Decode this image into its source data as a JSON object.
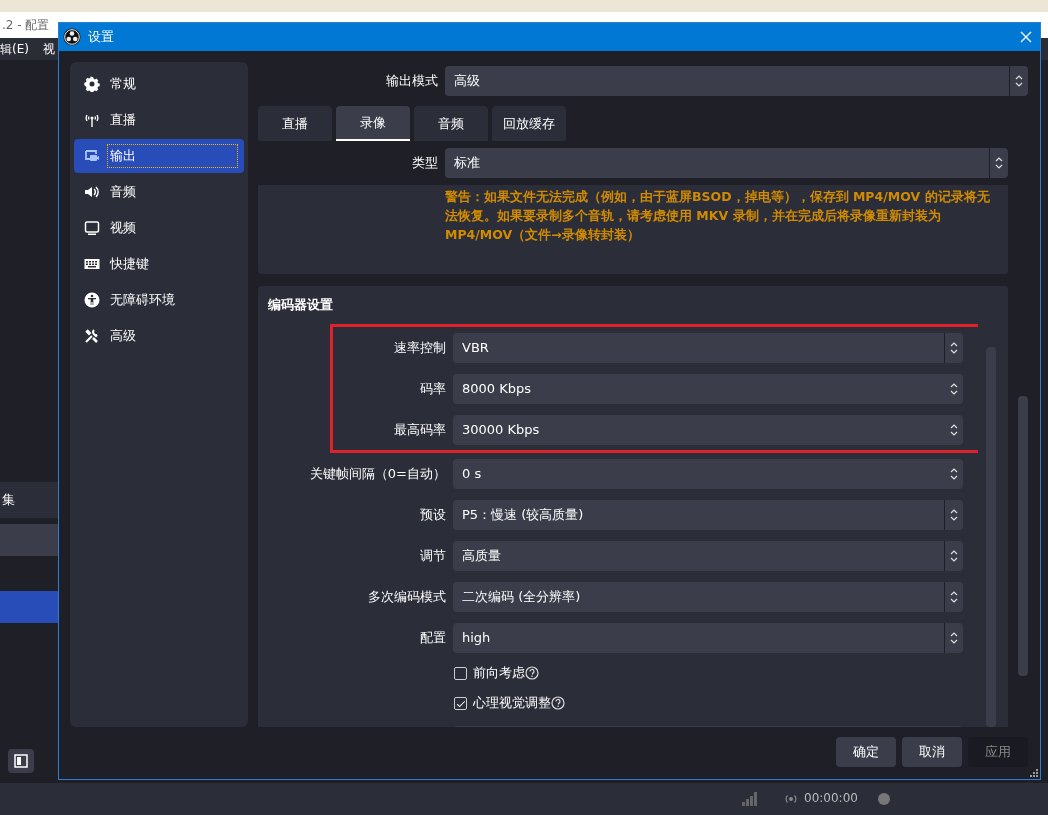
{
  "background_window": {
    "title": ".2 - 配置",
    "menu": [
      "辑(E)",
      "视"
    ],
    "dock_title": "集",
    "status_time": "00:00:00"
  },
  "window": {
    "title": "设置"
  },
  "sidebar": {
    "items": [
      {
        "label": "常规",
        "selected": false
      },
      {
        "label": "直播",
        "selected": false
      },
      {
        "label": "输出",
        "selected": true
      },
      {
        "label": "音频",
        "selected": false
      },
      {
        "label": "视频",
        "selected": false
      },
      {
        "label": "快捷键",
        "selected": false
      },
      {
        "label": "无障碍环境",
        "selected": false
      },
      {
        "label": "高级",
        "selected": false
      }
    ]
  },
  "output_mode": {
    "label": "输出模式",
    "value": "高级"
  },
  "tabs": [
    {
      "label": "直播",
      "selected": false
    },
    {
      "label": "录像",
      "selected": true
    },
    {
      "label": "音频",
      "selected": false
    },
    {
      "label": "回放缓存",
      "selected": false
    }
  ],
  "recording": {
    "type_label": "类型",
    "type_value": "标准",
    "warning": "警告：如果文件无法完成（例如，由于蓝屏BSOD，掉电等），保存到 MP4/MOV 的记录将无法恢复。如果要录制多个音轨，请考虑使用 MKV 录制，并在完成后将录像重新封装为 MP4/MOV（文件→录像转封装）"
  },
  "encoder": {
    "title": "编码器设置",
    "rows": [
      {
        "kind": "combo",
        "label": "速率控制",
        "value": "VBR"
      },
      {
        "kind": "spin",
        "label": "码率",
        "value": "8000 Kbps"
      },
      {
        "kind": "spin",
        "label": "最高码率",
        "value": "30000 Kbps"
      },
      {
        "kind": "spin",
        "label": "关键帧间隔（0=自动）",
        "value": "0 s"
      },
      {
        "kind": "combo",
        "label": "预设",
        "value": "P5：慢速 (较高质量)"
      },
      {
        "kind": "combo",
        "label": "调节",
        "value": "高质量"
      },
      {
        "kind": "combo",
        "label": "多次编码模式",
        "value": "二次编码 (全分辨率)"
      },
      {
        "kind": "combo",
        "label": "配置",
        "value": "high"
      },
      {
        "kind": "checkbox",
        "label": "前向考虑",
        "checked": false
      },
      {
        "kind": "checkbox",
        "label": "心理视觉调整",
        "checked": true
      }
    ]
  },
  "buttons": [
    {
      "label": "确定",
      "disabled": false
    },
    {
      "label": "取消",
      "disabled": false
    },
    {
      "label": "应用",
      "disabled": true
    }
  ]
}
